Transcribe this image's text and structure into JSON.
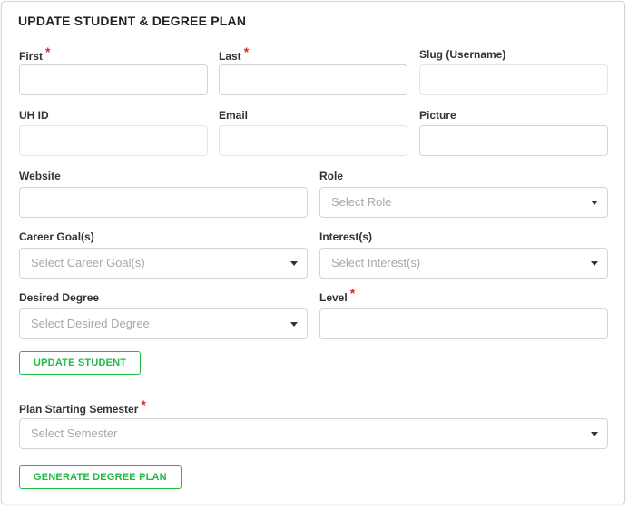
{
  "form": {
    "title": "UPDATE STUDENT & DEGREE PLAN",
    "required_marker": "*",
    "first": {
      "label": "First",
      "value": ""
    },
    "last": {
      "label": "Last",
      "value": ""
    },
    "slug": {
      "label": "Slug (Username)",
      "value": ""
    },
    "uhid": {
      "label": "UH ID",
      "value": ""
    },
    "email": {
      "label": "Email",
      "value": ""
    },
    "picture": {
      "label": "Picture",
      "value": ""
    },
    "website": {
      "label": "Website",
      "value": ""
    },
    "role": {
      "label": "Role",
      "placeholder": "Select Role"
    },
    "career_goals": {
      "label": "Career Goal(s)",
      "placeholder": "Select Career Goal(s)"
    },
    "interests": {
      "label": "Interest(s)",
      "placeholder": "Select Interest(s)"
    },
    "desired_degree": {
      "label": "Desired Degree",
      "placeholder": "Select Desired Degree"
    },
    "level": {
      "label": "Level",
      "value": ""
    },
    "update_button": "UPDATE STUDENT",
    "plan_semester": {
      "label": "Plan Starting Semester",
      "placeholder": "Select Semester"
    },
    "generate_button": "GENERATE DEGREE PLAN"
  },
  "colors": {
    "accent_green": "#21ba45",
    "required_red": "#db2828"
  }
}
